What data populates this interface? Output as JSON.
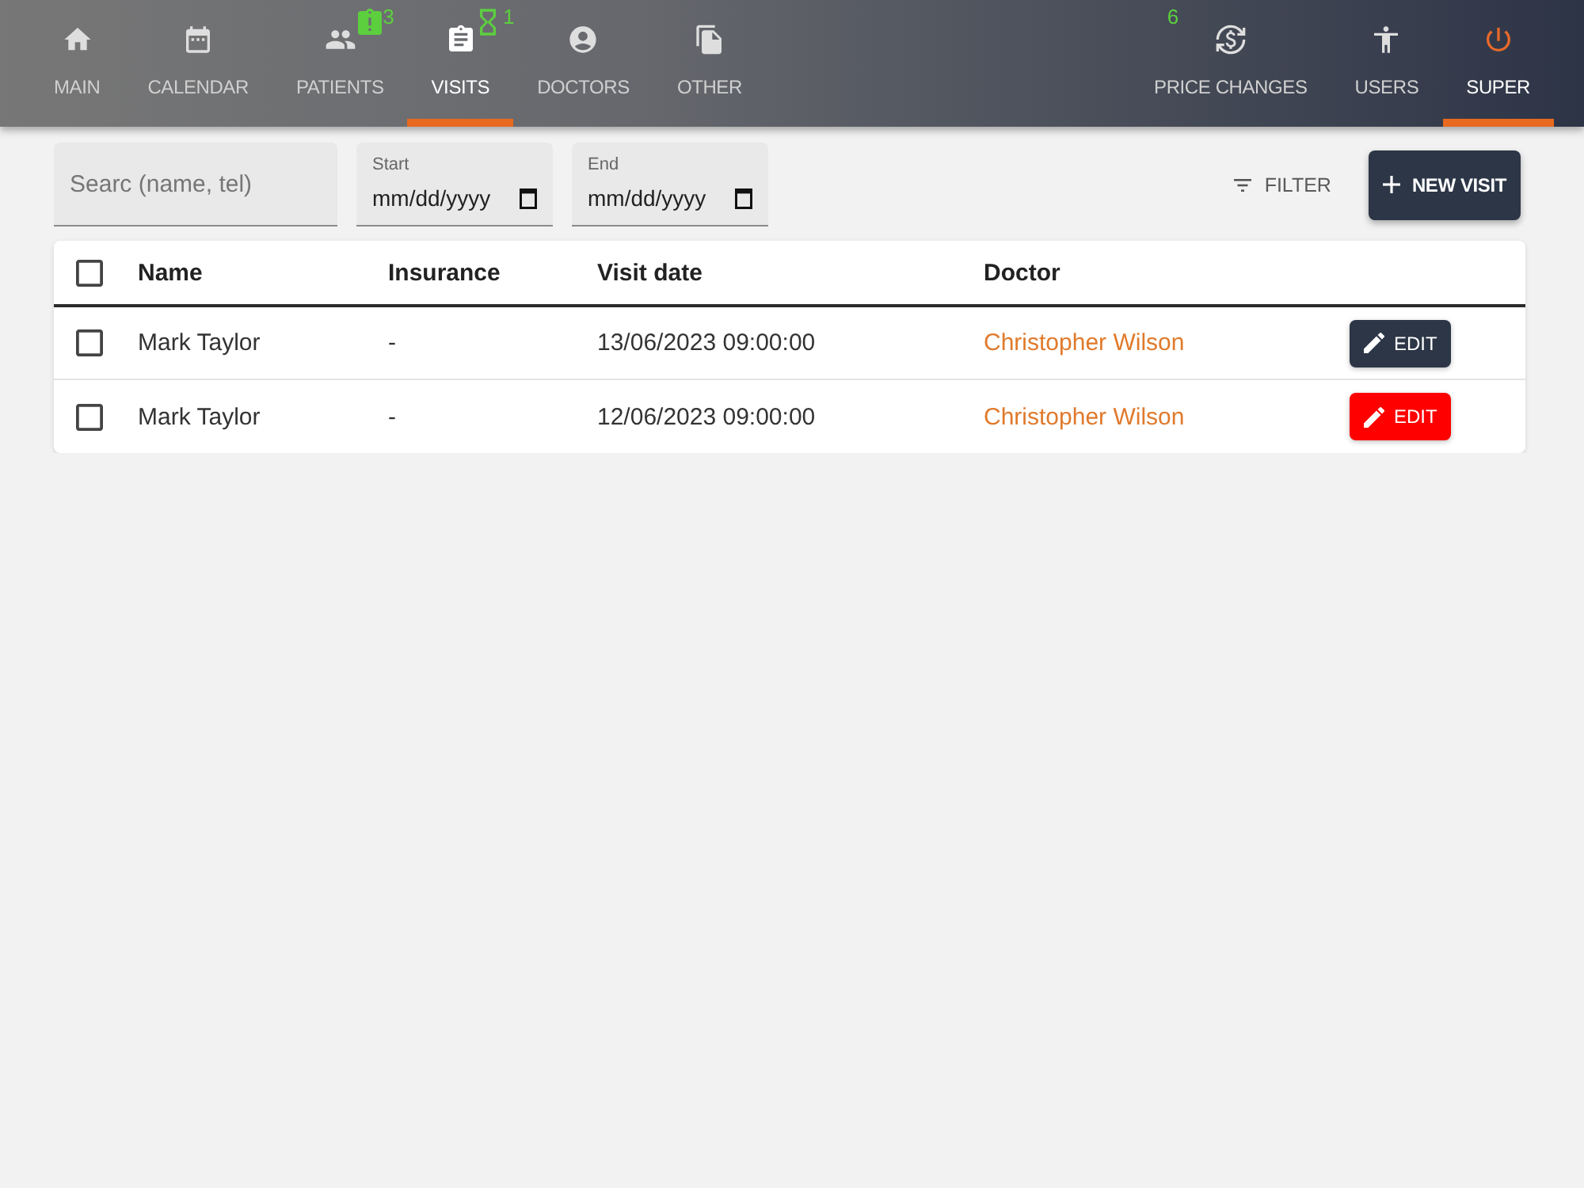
{
  "nav": {
    "left_tabs": [
      {
        "label": "MAIN",
        "selected": false
      },
      {
        "label": "CALENDAR",
        "selected": false
      },
      {
        "label": "PATIENTS",
        "selected": false,
        "badge": {
          "kind": "alert",
          "count": "3"
        }
      },
      {
        "label": "VISITS",
        "selected": true,
        "badge": {
          "kind": "pending",
          "count": "1"
        }
      },
      {
        "label": "DOCTORS",
        "selected": false
      },
      {
        "label": "OTHER",
        "selected": false
      }
    ],
    "right_tabs": [
      {
        "label": "PRICE CHANGES",
        "selected": false,
        "badge": {
          "kind": "count",
          "count": "6"
        }
      },
      {
        "label": "USERS",
        "selected": false
      },
      {
        "label": "SUPER",
        "selected": true
      }
    ]
  },
  "toolbar": {
    "search": {
      "placeholder": "Searc (name, tel)"
    },
    "start": {
      "label": "Start",
      "placeholder": "mm/dd/yyyy"
    },
    "end": {
      "label": "End",
      "placeholder": "mm/dd/yyyy"
    },
    "filter_button": "FILTER",
    "new_button": "NEW VISIT"
  },
  "table": {
    "select_all": {
      "checked": false
    },
    "columns": [
      "Name",
      "Insurance",
      "Visit date",
      "Doctor"
    ],
    "rows": [
      {
        "checked": false,
        "name": "Mark Taylor",
        "insurance": "-",
        "visit_date": "13/06/2023 09:00:00",
        "doctor": "Christopher Wilson",
        "edit": {
          "label": "EDIT",
          "color": "#2c3646"
        }
      },
      {
        "checked": false,
        "name": "Mark Taylor",
        "insurance": "-",
        "visit_date": "12/06/2023 09:00:00",
        "doctor": "Christopher Wilson",
        "edit": {
          "label": "EDIT",
          "color": "#ff0000"
        }
      }
    ]
  }
}
